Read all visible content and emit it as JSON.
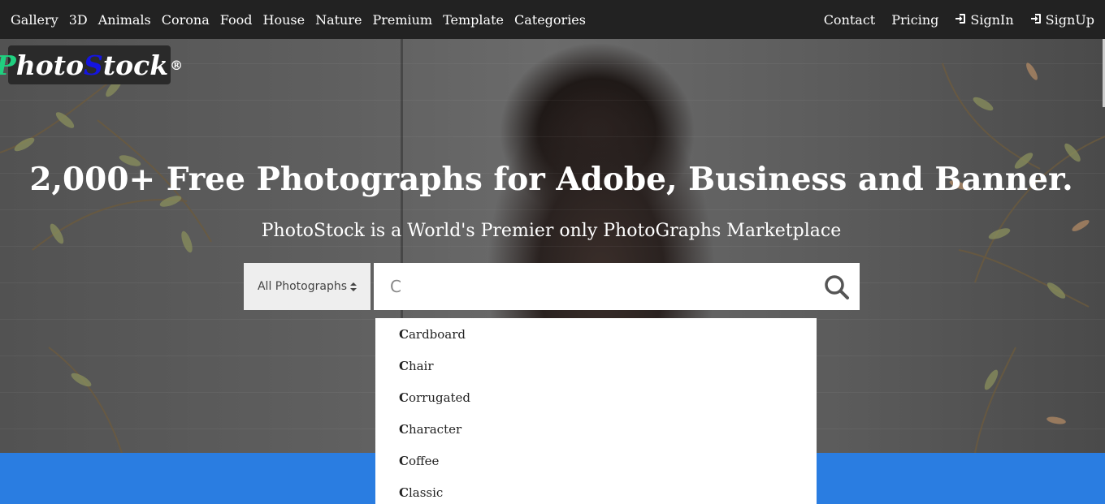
{
  "nav": {
    "left": [
      "Gallery",
      "3D",
      "Animals",
      "Corona",
      "Food",
      "House",
      "Nature",
      "Premium",
      "Template",
      "Categories"
    ],
    "contact": "Contact",
    "pricing": "Pricing",
    "signin": "SignIn",
    "signup": "SignUp"
  },
  "logo": {
    "p": "P",
    "hoto": "hoto",
    "s": "S",
    "tock": "tock",
    "reg": "®"
  },
  "hero": {
    "title": "2,000+ Free Photographs for Adobe, Business and Banner.",
    "subtitle": "PhotoStock is a World's Premier only PhotoGraphs Marketplace"
  },
  "search": {
    "category": "All Photographs",
    "value": "C"
  },
  "autocomplete": [
    {
      "match": "C",
      "rest": "ardboard"
    },
    {
      "match": "C",
      "rest": "hair"
    },
    {
      "match": "C",
      "rest": "orrugated"
    },
    {
      "match": "C",
      "rest": "haracter"
    },
    {
      "match": "C",
      "rest": "offee"
    },
    {
      "match": "C",
      "rest": "lassic"
    }
  ],
  "colors": {
    "navbar": "#222222",
    "band": "#2a7de1",
    "logo_p": "#20d080",
    "logo_s": "#1515e0"
  },
  "icons": {
    "signin": "sign-in-icon",
    "signup": "sign-in-icon",
    "search": "search-icon",
    "sort": "sort-caret-icon"
  }
}
